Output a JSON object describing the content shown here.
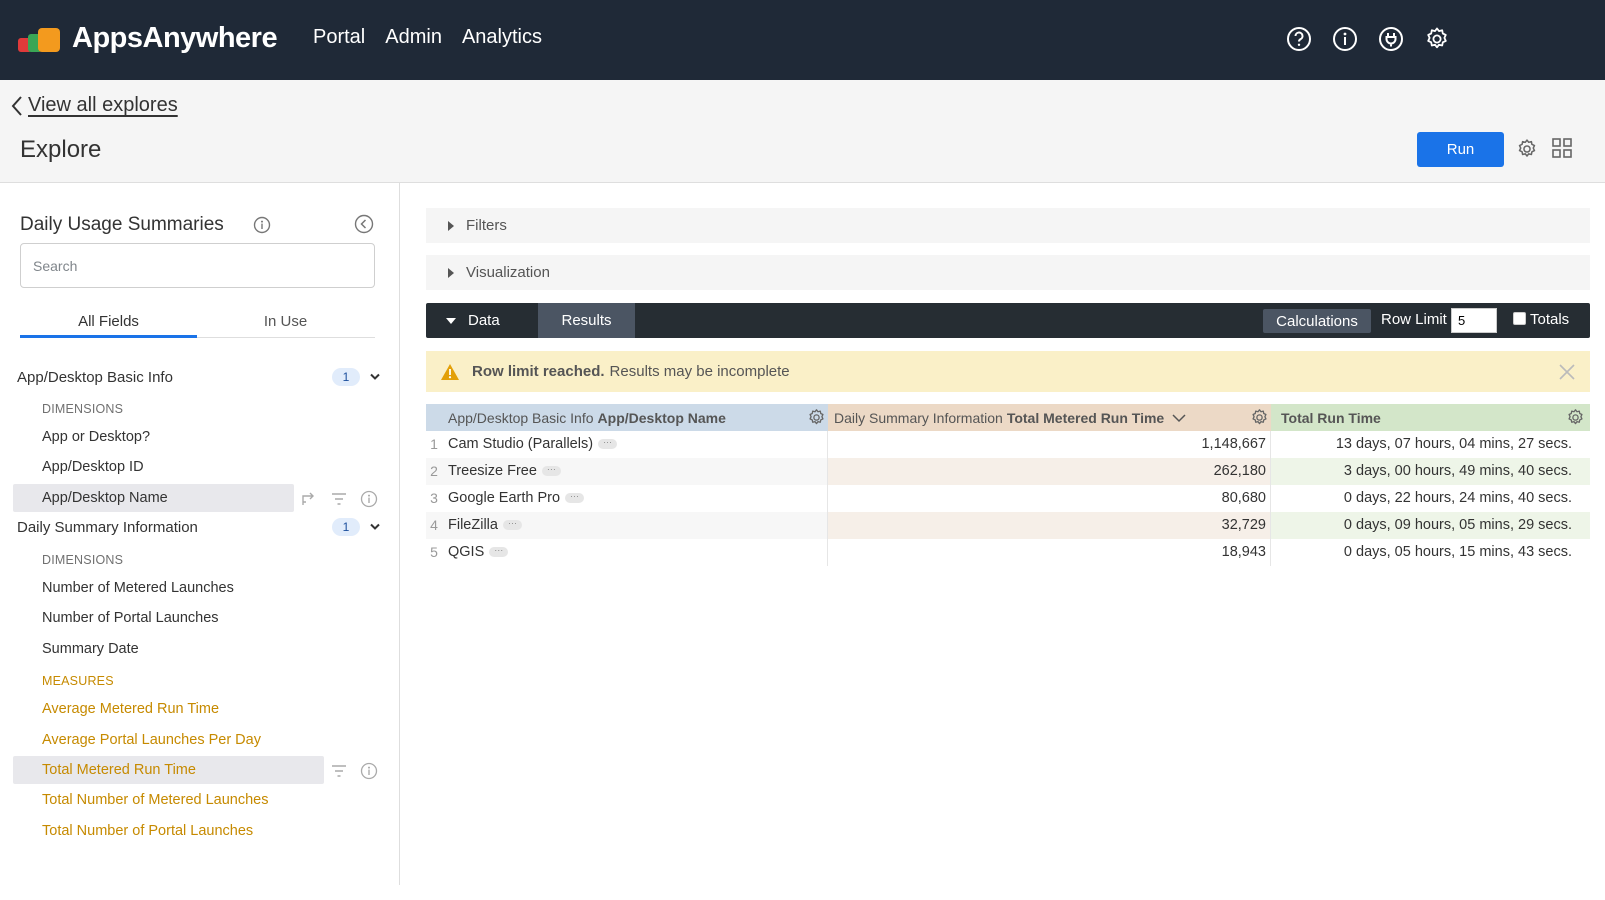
{
  "app": {
    "name": "AppsAnywhere"
  },
  "nav": {
    "items": [
      "Portal",
      "Admin",
      "Analytics"
    ]
  },
  "header": {
    "back_label": "View all explores",
    "title": "Explore",
    "run_label": "Run"
  },
  "sidebar": {
    "title": "Daily Usage Summaries",
    "search_placeholder": "Search",
    "tabs": [
      "All Fields",
      "In Use"
    ],
    "groups": [
      {
        "name": "App/Desktop Basic Info",
        "count": "1",
        "dimensions_label": "DIMENSIONS",
        "dimensions": [
          "App or Desktop?",
          "App/Desktop ID",
          "App/Desktop Name"
        ]
      },
      {
        "name": "Daily Summary Information",
        "count": "1",
        "dimensions_label": "DIMENSIONS",
        "dimensions": [
          "Number of Metered Launches",
          "Number of Portal Launches",
          "Summary Date"
        ],
        "measures_label": "MEASURES",
        "measures": [
          "Average Metered Run Time",
          "Average Portal Launches Per Day",
          "Total Metered Run Time",
          "Total Number of Metered Launches",
          "Total Number of Portal Launches"
        ]
      }
    ]
  },
  "main": {
    "filters_label": "Filters",
    "visualization_label": "Visualization",
    "data_tab": "Data",
    "results_tab": "Results",
    "calculations_label": "Calculations",
    "row_limit_label": "Row Limit",
    "row_limit_value": "5",
    "totals_label": "Totals",
    "warning_bold": "Row limit reached.",
    "warning_text": "Results may be incomplete"
  },
  "table": {
    "columns": [
      {
        "group": "App/Desktop Basic Info",
        "field": "App/Desktop Name"
      },
      {
        "group": "Daily Summary Information",
        "field": "Total Metered Run Time"
      },
      {
        "group": "",
        "field": "Total Run Time"
      }
    ],
    "rows": [
      {
        "n": "1",
        "name": "Cam Studio (Parallels)",
        "metered": "1,148,667",
        "total": "13 days, 07 hours, 04 mins, 27 secs."
      },
      {
        "n": "2",
        "name": "Treesize Free",
        "metered": "262,180",
        "total": "3 days, 00 hours, 49 mins, 40 secs."
      },
      {
        "n": "3",
        "name": "Google Earth Pro",
        "metered": "80,680",
        "total": "0 days, 22 hours, 24 mins, 40 secs."
      },
      {
        "n": "4",
        "name": "FileZilla",
        "metered": "32,729",
        "total": "0 days, 09 hours, 05 mins, 29 secs."
      },
      {
        "n": "5",
        "name": "QGIS",
        "metered": "18,943",
        "total": "0 days, 05 hours, 15 mins, 43 secs."
      }
    ]
  },
  "colors": {
    "topbar": "#1f2937",
    "run_button": "#1a73e8",
    "measure": "#c68a00",
    "dimension_header": "#ccdae8",
    "measure_header": "#ecd9c6",
    "table_calc_header": "#d3e6c9",
    "warning": "#faf0c8"
  },
  "icons": [
    "help-icon",
    "info-icon",
    "plug-icon",
    "gear-icon",
    "chevron-left-icon",
    "grid-icon",
    "collapse-icon",
    "warning-icon",
    "close-icon",
    "pivot-icon",
    "filter-icon",
    "sort-desc-icon"
  ]
}
